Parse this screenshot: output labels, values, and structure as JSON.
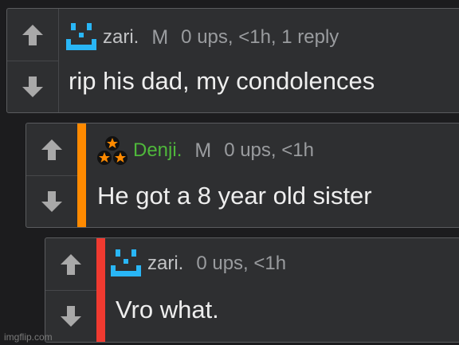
{
  "comments": [
    {
      "avatar_icon": "pixel-face-icon",
      "avatar_color": "#29b6f6",
      "username": "zari.",
      "badge": "M",
      "meta": "0 ups, <1h, 1 reply",
      "text": "rip his dad, my condolences"
    },
    {
      "avatar_icon": "triple-star-icon",
      "accent_color": "#ff8a00",
      "username": "Denji.",
      "username_color": "#4fb83b",
      "badge": "M",
      "meta": "0 ups, <1h",
      "text": "He got a 8 year old sister"
    },
    {
      "avatar_icon": "pixel-face-icon",
      "avatar_color": "#29b6f6",
      "accent_color": "#f03a30",
      "username": "zari.",
      "meta": "0 ups, <1h",
      "text": "Vro what."
    }
  ],
  "icons": {
    "upvote": "arrow-up-icon",
    "downvote": "arrow-down-icon"
  },
  "watermark": "imgflip.com"
}
